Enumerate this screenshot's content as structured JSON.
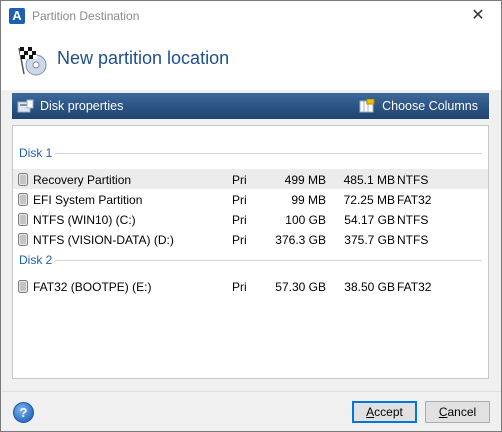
{
  "window": {
    "title": "Partition Destination",
    "app_icon_letter": "A",
    "close_glyph": "✕"
  },
  "header": {
    "title": "New partition location",
    "icon": "checkered-flag-disc-icon"
  },
  "toolbar": {
    "disk_properties_label": "Disk properties",
    "choose_columns_label": "Choose Columns"
  },
  "disks": [
    {
      "label": "Disk 1",
      "partitions": [
        {
          "name": "Recovery Partition",
          "type": "Pri",
          "capacity": "499 MB",
          "free": "485.1 MB",
          "fs": "NTFS",
          "selected": true
        },
        {
          "name": "EFI System Partition",
          "type": "Pri",
          "capacity": "99 MB",
          "free": "72.25 MB",
          "fs": "FAT32",
          "selected": false
        },
        {
          "name": "NTFS (WIN10) (C:)",
          "type": "Pri",
          "capacity": "100 GB",
          "free": "54.17 GB",
          "fs": "NTFS",
          "selected": false
        },
        {
          "name": "NTFS (VISION-DATA) (D:)",
          "type": "Pri",
          "capacity": "376.3 GB",
          "free": "375.7 GB",
          "fs": "NTFS",
          "selected": false
        }
      ]
    },
    {
      "label": "Disk 2",
      "partitions": [
        {
          "name": "FAT32 (BOOTPE) (E:)",
          "type": "Pri",
          "capacity": "57.30 GB",
          "free": "38.50 GB",
          "fs": "FAT32",
          "selected": false
        }
      ]
    }
  ],
  "footer": {
    "help_glyph": "?",
    "accept_label_prefix": "",
    "accept_mnemonic": "A",
    "accept_label_rest": "ccept",
    "cancel_label_prefix": "",
    "cancel_mnemonic": "C",
    "cancel_label_rest": "ancel"
  }
}
